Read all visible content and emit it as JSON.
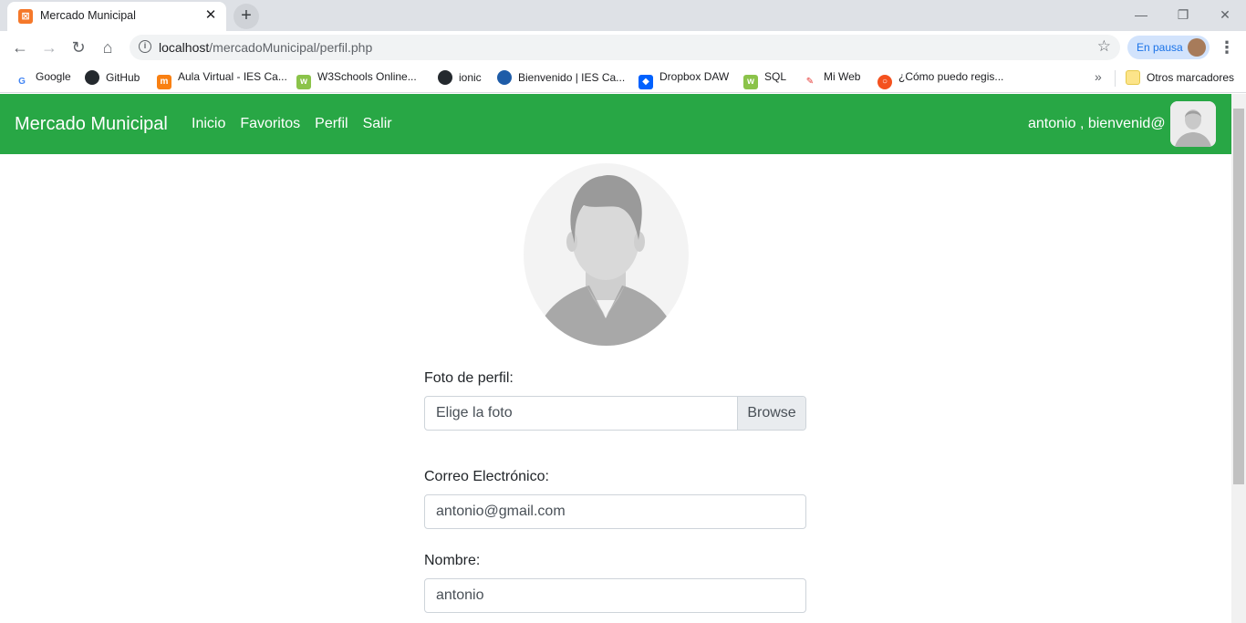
{
  "browser": {
    "tab_title": "Mercado Municipal",
    "url_host": "localhost",
    "url_path": "/mercadoMunicipal/perfil.php",
    "profile_status": "En pausa",
    "bookmarks": [
      {
        "label": "Google",
        "icon": "google-icon",
        "color": "#4285f4"
      },
      {
        "label": "GitHub",
        "icon": "github-icon",
        "color": "#24292e"
      },
      {
        "label": "Aula Virtual - IES Ca...",
        "icon": "moodle-icon",
        "color": "#f98012"
      },
      {
        "label": "W3Schools Online...",
        "icon": "w3schools-icon",
        "color": "#8bc34a"
      },
      {
        "label": "ionic",
        "icon": "github-icon",
        "color": "#24292e"
      },
      {
        "label": "Bienvenido | IES Ca...",
        "icon": "site-icon",
        "color": "#1e5ca8"
      },
      {
        "label": "Dropbox DAW",
        "icon": "dropbox-icon",
        "color": "#0061fe"
      },
      {
        "label": "SQL",
        "icon": "w3schools-icon",
        "color": "#8bc34a"
      },
      {
        "label": "Mi Web",
        "icon": "web-icon",
        "color": "#e53935"
      },
      {
        "label": "¿Cómo puedo regis...",
        "icon": "help-icon",
        "color": "#f4511e"
      }
    ],
    "other_bookmarks": "Otros marcadores"
  },
  "nav": {
    "brand": "Mercado Municipal",
    "links": [
      "Inicio",
      "Favoritos",
      "Perfil",
      "Salir"
    ],
    "welcome": "antonio , bienvenid@"
  },
  "form": {
    "photo_label": "Foto de perfil:",
    "photo_placeholder": "Elige la foto",
    "browse_label": "Browse",
    "email_label": "Correo Electrónico:",
    "email_value": "antonio@gmail.com",
    "name_label": "Nombre:",
    "name_value": "antonio"
  },
  "colors": {
    "navbar": "#28a745"
  }
}
